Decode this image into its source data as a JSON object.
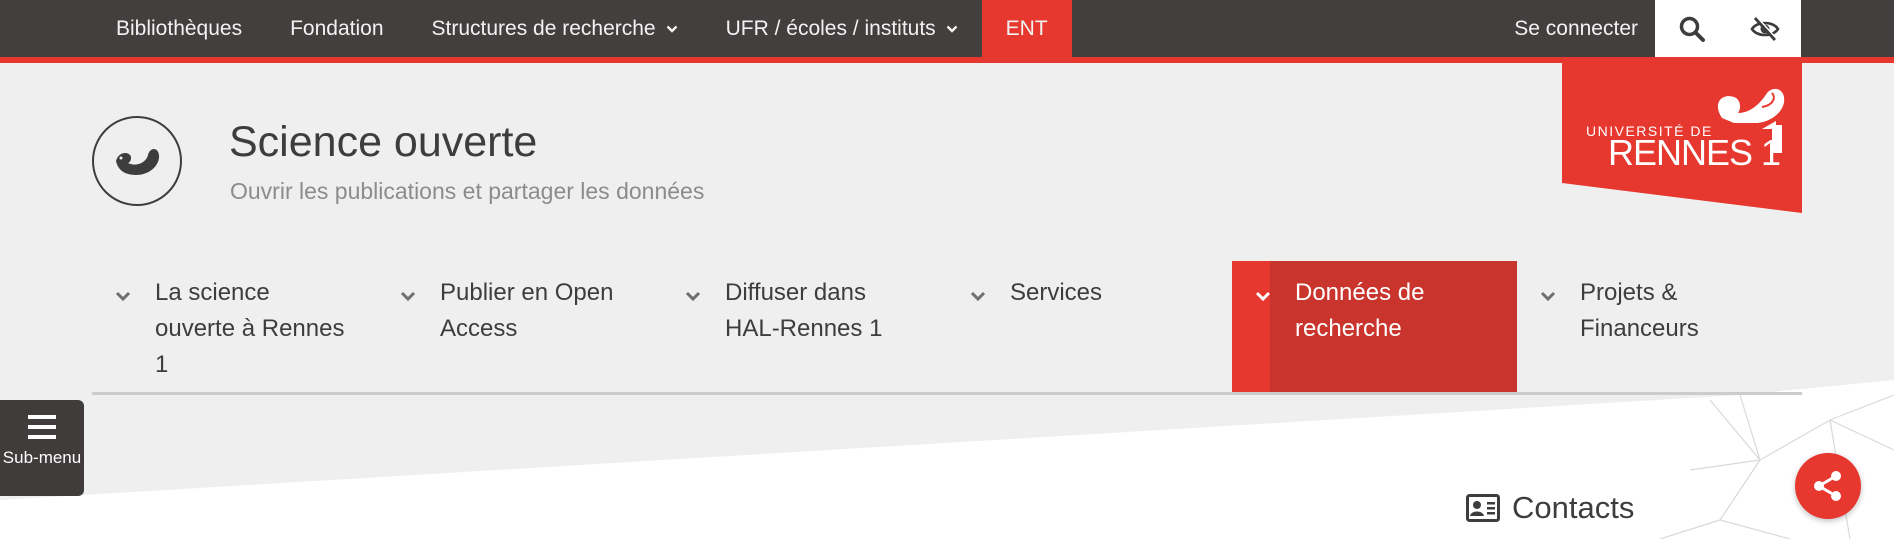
{
  "topnav": {
    "items": [
      {
        "label": "Bibliothèques",
        "has_dropdown": false
      },
      {
        "label": "Fondation",
        "has_dropdown": false
      },
      {
        "label": "Structures de recherche",
        "has_dropdown": true
      },
      {
        "label": "UFR / écoles / instituts",
        "has_dropdown": true
      },
      {
        "label": "ENT",
        "has_dropdown": false,
        "highlight": true
      }
    ],
    "login_label": "Se connecter",
    "search_icon": "search-icon",
    "accessibility_icon": "eye-slash-icon"
  },
  "logo": {
    "line1": "UNIVERSITÉ DE",
    "line2": "RENNES 1"
  },
  "site": {
    "title": "Science ouverte",
    "subtitle": "Ouvrir les publications et partager les données"
  },
  "mainnav": {
    "items": [
      {
        "label": "La science ouverte à Rennes 1",
        "active": false
      },
      {
        "label": "Publier en Open Access",
        "active": false
      },
      {
        "label": "Diffuser dans HAL-Rennes 1",
        "active": false
      },
      {
        "label": "Services",
        "active": false
      },
      {
        "label": "Données de recherche",
        "active": true
      },
      {
        "label": "Projets & Financeurs",
        "active": false
      }
    ]
  },
  "submenu": {
    "label": "Sub-menu"
  },
  "contacts": {
    "title": "Contacts"
  },
  "colors": {
    "accent": "#e6382e",
    "active_nav": "#c9342c",
    "topbar": "#423f3e",
    "background": "#efefef"
  }
}
